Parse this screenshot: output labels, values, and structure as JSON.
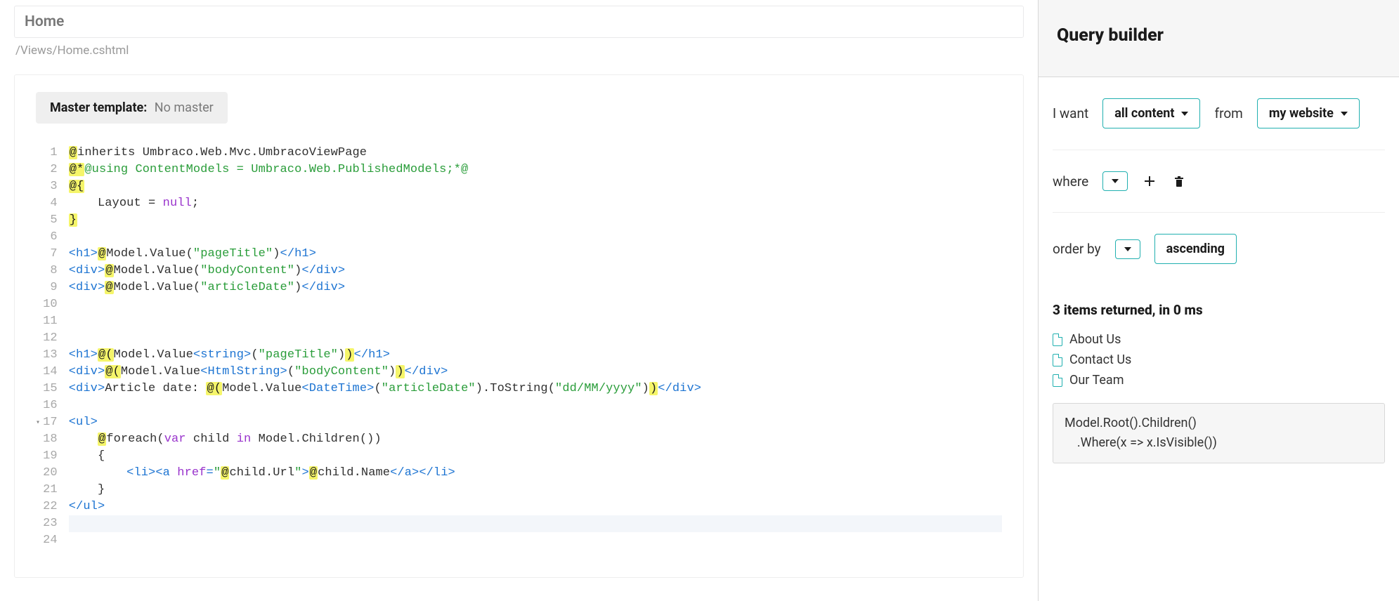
{
  "header": {
    "title": "Home",
    "path": "/Views/Home.cshtml"
  },
  "master": {
    "label": "Master template:",
    "value": "No master"
  },
  "editor": {
    "fold_line": 17,
    "active_line": 23,
    "lines": [
      {
        "n": 1,
        "segs": [
          {
            "t": "@",
            "c": "hl"
          },
          {
            "t": "inherits Umbraco.Web.Mvc.UmbracoViewPage",
            "c": "txt"
          }
        ]
      },
      {
        "n": 2,
        "segs": [
          {
            "t": "@*",
            "c": "hl"
          },
          {
            "t": "@using ContentModels = Umbraco.Web.PublishedModels;*@",
            "c": "str"
          }
        ]
      },
      {
        "n": 3,
        "segs": [
          {
            "t": "@{",
            "c": "hl"
          }
        ]
      },
      {
        "n": 4,
        "segs": [
          {
            "t": "    Layout = ",
            "c": "txt"
          },
          {
            "t": "null",
            "c": "kw"
          },
          {
            "t": ";",
            "c": "txt"
          }
        ]
      },
      {
        "n": 5,
        "segs": [
          {
            "t": "}",
            "c": "hl"
          }
        ]
      },
      {
        "n": 6,
        "segs": [
          {
            "t": "",
            "c": "txt"
          }
        ]
      },
      {
        "n": 7,
        "segs": [
          {
            "t": "<h1>",
            "c": "tag"
          },
          {
            "t": "@",
            "c": "hl"
          },
          {
            "t": "Model.Value(",
            "c": "txt"
          },
          {
            "t": "\"pageTitle\"",
            "c": "str"
          },
          {
            "t": ")",
            "c": "txt"
          },
          {
            "t": "</h1>",
            "c": "tag"
          }
        ]
      },
      {
        "n": 8,
        "segs": [
          {
            "t": "<div>",
            "c": "tag"
          },
          {
            "t": "@",
            "c": "hl"
          },
          {
            "t": "Model.Value(",
            "c": "txt"
          },
          {
            "t": "\"bodyContent\"",
            "c": "str"
          },
          {
            "t": ")",
            "c": "txt"
          },
          {
            "t": "</div>",
            "c": "tag"
          }
        ]
      },
      {
        "n": 9,
        "segs": [
          {
            "t": "<div>",
            "c": "tag"
          },
          {
            "t": "@",
            "c": "hl"
          },
          {
            "t": "Model.Value(",
            "c": "txt"
          },
          {
            "t": "\"articleDate\"",
            "c": "str"
          },
          {
            "t": ")",
            "c": "txt"
          },
          {
            "t": "</div>",
            "c": "tag"
          }
        ]
      },
      {
        "n": 10,
        "segs": [
          {
            "t": "",
            "c": "txt"
          }
        ]
      },
      {
        "n": 11,
        "segs": [
          {
            "t": "",
            "c": "txt"
          }
        ]
      },
      {
        "n": 12,
        "segs": [
          {
            "t": "",
            "c": "txt"
          }
        ]
      },
      {
        "n": 13,
        "segs": [
          {
            "t": "<h1>",
            "c": "tag"
          },
          {
            "t": "@(",
            "c": "hl"
          },
          {
            "t": "Model.Value",
            "c": "txt"
          },
          {
            "t": "<string>",
            "c": "tag"
          },
          {
            "t": "(",
            "c": "txt"
          },
          {
            "t": "\"pageTitle\"",
            "c": "str"
          },
          {
            "t": ")",
            "c": "txt"
          },
          {
            "t": ")",
            "c": "hl"
          },
          {
            "t": "</h1>",
            "c": "tag"
          }
        ]
      },
      {
        "n": 14,
        "segs": [
          {
            "t": "<div>",
            "c": "tag"
          },
          {
            "t": "@(",
            "c": "hl"
          },
          {
            "t": "Model.Value",
            "c": "txt"
          },
          {
            "t": "<HtmlString>",
            "c": "tag"
          },
          {
            "t": "(",
            "c": "txt"
          },
          {
            "t": "\"bodyContent\"",
            "c": "str"
          },
          {
            "t": ")",
            "c": "txt"
          },
          {
            "t": ")",
            "c": "hl"
          },
          {
            "t": "</div>",
            "c": "tag"
          }
        ]
      },
      {
        "n": 15,
        "segs": [
          {
            "t": "<div>",
            "c": "tag"
          },
          {
            "t": "Article date: ",
            "c": "txt"
          },
          {
            "t": "@(",
            "c": "hl"
          },
          {
            "t": "Model.Value",
            "c": "txt"
          },
          {
            "t": "<DateTime>",
            "c": "tag"
          },
          {
            "t": "(",
            "c": "txt"
          },
          {
            "t": "\"articleDate\"",
            "c": "str"
          },
          {
            "t": ").ToString(",
            "c": "txt"
          },
          {
            "t": "\"dd/MM/yyyy\"",
            "c": "str"
          },
          {
            "t": ")",
            "c": "txt"
          },
          {
            "t": ")",
            "c": "hl"
          },
          {
            "t": "</div>",
            "c": "tag"
          }
        ]
      },
      {
        "n": 16,
        "segs": [
          {
            "t": "",
            "c": "txt"
          }
        ]
      },
      {
        "n": 17,
        "segs": [
          {
            "t": "<ul>",
            "c": "tag"
          }
        ]
      },
      {
        "n": 18,
        "segs": [
          {
            "t": "    ",
            "c": "txt"
          },
          {
            "t": "@",
            "c": "hl"
          },
          {
            "t": "foreach(",
            "c": "txt"
          },
          {
            "t": "var",
            "c": "kw"
          },
          {
            "t": " child ",
            "c": "txt"
          },
          {
            "t": "in",
            "c": "kw"
          },
          {
            "t": " Model.Children())",
            "c": "txt"
          }
        ]
      },
      {
        "n": 19,
        "segs": [
          {
            "t": "    {",
            "c": "txt"
          }
        ]
      },
      {
        "n": 20,
        "segs": [
          {
            "t": "        ",
            "c": "txt"
          },
          {
            "t": "<li><a ",
            "c": "tag"
          },
          {
            "t": "href",
            "c": "attr"
          },
          {
            "t": "=",
            "c": "tag"
          },
          {
            "t": "\"",
            "c": "str"
          },
          {
            "t": "@",
            "c": "hl"
          },
          {
            "t": "child.Url",
            "c": "txt"
          },
          {
            "t": "\"",
            "c": "str"
          },
          {
            "t": ">",
            "c": "tag"
          },
          {
            "t": "@",
            "c": "hl"
          },
          {
            "t": "child.Name",
            "c": "txt"
          },
          {
            "t": "</a></li>",
            "c": "tag"
          }
        ]
      },
      {
        "n": 21,
        "segs": [
          {
            "t": "    }",
            "c": "txt"
          }
        ]
      },
      {
        "n": 22,
        "segs": [
          {
            "t": "</ul>",
            "c": "tag"
          }
        ]
      },
      {
        "n": 23,
        "segs": [
          {
            "t": "",
            "c": "txt"
          }
        ]
      },
      {
        "n": 24,
        "segs": [
          {
            "t": "",
            "c": "txt"
          }
        ]
      }
    ]
  },
  "query": {
    "title": "Query builder",
    "iwant_label": "I want",
    "iwant_value": "all content",
    "from_label": "from",
    "from_value": "my website",
    "where_label": "where",
    "orderby_label": "order by",
    "order_dir": "ascending",
    "results_text": "3 items returned, in 0 ms",
    "results": [
      "About Us",
      "Contact Us",
      "Our Team"
    ],
    "code": "Model.Root().Children()\n    .Where(x => x.IsVisible())"
  }
}
